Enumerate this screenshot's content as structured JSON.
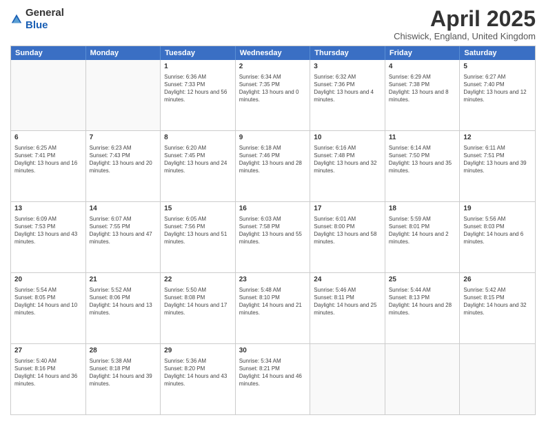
{
  "header": {
    "logo_general": "General",
    "logo_blue": "Blue",
    "month_title": "April 2025",
    "location": "Chiswick, England, United Kingdom"
  },
  "days_of_week": [
    "Sunday",
    "Monday",
    "Tuesday",
    "Wednesday",
    "Thursday",
    "Friday",
    "Saturday"
  ],
  "weeks": [
    [
      {
        "day": "",
        "info": ""
      },
      {
        "day": "",
        "info": ""
      },
      {
        "day": "1",
        "info": "Sunrise: 6:36 AM\nSunset: 7:33 PM\nDaylight: 12 hours and 56 minutes."
      },
      {
        "day": "2",
        "info": "Sunrise: 6:34 AM\nSunset: 7:35 PM\nDaylight: 13 hours and 0 minutes."
      },
      {
        "day": "3",
        "info": "Sunrise: 6:32 AM\nSunset: 7:36 PM\nDaylight: 13 hours and 4 minutes."
      },
      {
        "day": "4",
        "info": "Sunrise: 6:29 AM\nSunset: 7:38 PM\nDaylight: 13 hours and 8 minutes."
      },
      {
        "day": "5",
        "info": "Sunrise: 6:27 AM\nSunset: 7:40 PM\nDaylight: 13 hours and 12 minutes."
      }
    ],
    [
      {
        "day": "6",
        "info": "Sunrise: 6:25 AM\nSunset: 7:41 PM\nDaylight: 13 hours and 16 minutes."
      },
      {
        "day": "7",
        "info": "Sunrise: 6:23 AM\nSunset: 7:43 PM\nDaylight: 13 hours and 20 minutes."
      },
      {
        "day": "8",
        "info": "Sunrise: 6:20 AM\nSunset: 7:45 PM\nDaylight: 13 hours and 24 minutes."
      },
      {
        "day": "9",
        "info": "Sunrise: 6:18 AM\nSunset: 7:46 PM\nDaylight: 13 hours and 28 minutes."
      },
      {
        "day": "10",
        "info": "Sunrise: 6:16 AM\nSunset: 7:48 PM\nDaylight: 13 hours and 32 minutes."
      },
      {
        "day": "11",
        "info": "Sunrise: 6:14 AM\nSunset: 7:50 PM\nDaylight: 13 hours and 35 minutes."
      },
      {
        "day": "12",
        "info": "Sunrise: 6:11 AM\nSunset: 7:51 PM\nDaylight: 13 hours and 39 minutes."
      }
    ],
    [
      {
        "day": "13",
        "info": "Sunrise: 6:09 AM\nSunset: 7:53 PM\nDaylight: 13 hours and 43 minutes."
      },
      {
        "day": "14",
        "info": "Sunrise: 6:07 AM\nSunset: 7:55 PM\nDaylight: 13 hours and 47 minutes."
      },
      {
        "day": "15",
        "info": "Sunrise: 6:05 AM\nSunset: 7:56 PM\nDaylight: 13 hours and 51 minutes."
      },
      {
        "day": "16",
        "info": "Sunrise: 6:03 AM\nSunset: 7:58 PM\nDaylight: 13 hours and 55 minutes."
      },
      {
        "day": "17",
        "info": "Sunrise: 6:01 AM\nSunset: 8:00 PM\nDaylight: 13 hours and 58 minutes."
      },
      {
        "day": "18",
        "info": "Sunrise: 5:59 AM\nSunset: 8:01 PM\nDaylight: 14 hours and 2 minutes."
      },
      {
        "day": "19",
        "info": "Sunrise: 5:56 AM\nSunset: 8:03 PM\nDaylight: 14 hours and 6 minutes."
      }
    ],
    [
      {
        "day": "20",
        "info": "Sunrise: 5:54 AM\nSunset: 8:05 PM\nDaylight: 14 hours and 10 minutes."
      },
      {
        "day": "21",
        "info": "Sunrise: 5:52 AM\nSunset: 8:06 PM\nDaylight: 14 hours and 13 minutes."
      },
      {
        "day": "22",
        "info": "Sunrise: 5:50 AM\nSunset: 8:08 PM\nDaylight: 14 hours and 17 minutes."
      },
      {
        "day": "23",
        "info": "Sunrise: 5:48 AM\nSunset: 8:10 PM\nDaylight: 14 hours and 21 minutes."
      },
      {
        "day": "24",
        "info": "Sunrise: 5:46 AM\nSunset: 8:11 PM\nDaylight: 14 hours and 25 minutes."
      },
      {
        "day": "25",
        "info": "Sunrise: 5:44 AM\nSunset: 8:13 PM\nDaylight: 14 hours and 28 minutes."
      },
      {
        "day": "26",
        "info": "Sunrise: 5:42 AM\nSunset: 8:15 PM\nDaylight: 14 hours and 32 minutes."
      }
    ],
    [
      {
        "day": "27",
        "info": "Sunrise: 5:40 AM\nSunset: 8:16 PM\nDaylight: 14 hours and 36 minutes."
      },
      {
        "day": "28",
        "info": "Sunrise: 5:38 AM\nSunset: 8:18 PM\nDaylight: 14 hours and 39 minutes."
      },
      {
        "day": "29",
        "info": "Sunrise: 5:36 AM\nSunset: 8:20 PM\nDaylight: 14 hours and 43 minutes."
      },
      {
        "day": "30",
        "info": "Sunrise: 5:34 AM\nSunset: 8:21 PM\nDaylight: 14 hours and 46 minutes."
      },
      {
        "day": "",
        "info": ""
      },
      {
        "day": "",
        "info": ""
      },
      {
        "day": "",
        "info": ""
      }
    ]
  ]
}
